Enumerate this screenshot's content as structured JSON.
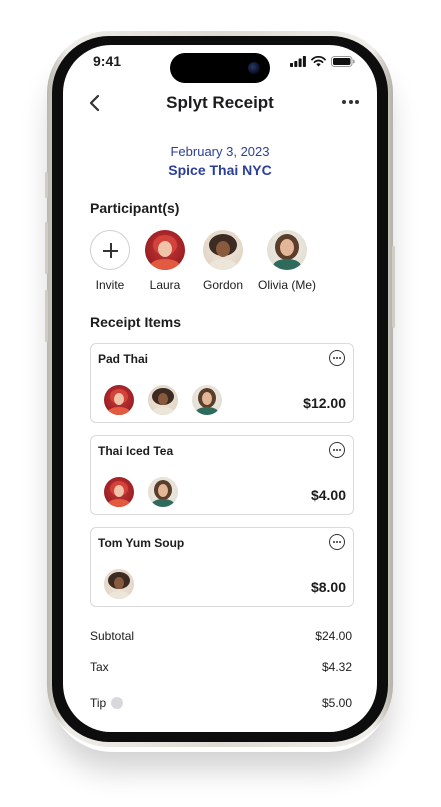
{
  "status_bar": {
    "time": "9:41"
  },
  "nav": {
    "title": "Splyt Receipt"
  },
  "receipt": {
    "date": "February 3, 2023",
    "restaurant": "Spice Thai NYC"
  },
  "participants_section": {
    "title": "Participant(s)",
    "invite_label": "Invite",
    "people": [
      {
        "name": "Laura"
      },
      {
        "name": "Gordon"
      },
      {
        "name": "Olivia (Me)"
      }
    ]
  },
  "items_section": {
    "title": "Receipt Items",
    "items": [
      {
        "name": "Pad Thai",
        "price": "$12.00",
        "assignees": [
          "Laura",
          "Gordon",
          "Olivia (Me)"
        ]
      },
      {
        "name": "Thai Iced Tea",
        "price": "$4.00",
        "assignees": [
          "Laura",
          "Olivia (Me)"
        ]
      },
      {
        "name": "Tom Yum Soup",
        "price": "$8.00",
        "assignees": [
          "Gordon"
        ]
      }
    ]
  },
  "summary": {
    "subtotal_label": "Subtotal",
    "subtotal": "$24.00",
    "tax_label": "Tax",
    "tax": "$4.32",
    "tip_label": "Tip",
    "tip": "$5.00"
  },
  "colors": {
    "accent": "#2b3f9a",
    "laura_bg": "#a32226",
    "gordon_bg": "#e2d6c6",
    "olivia_bg": "#e3dfd5"
  }
}
